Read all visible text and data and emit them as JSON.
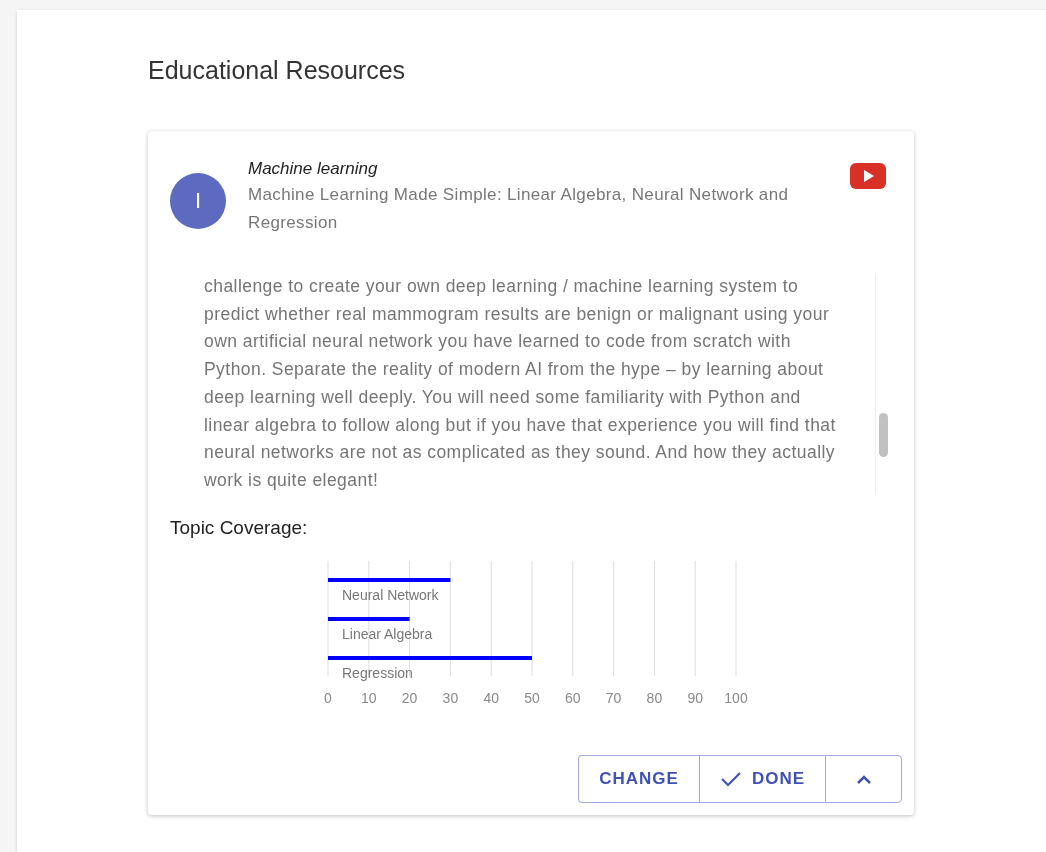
{
  "page": {
    "title": "Educational Resources"
  },
  "resource": {
    "avatar": "I",
    "topic": "Machine learning",
    "title": "Machine Learning Made Simple: Linear Algebra, Neural Network and Regression",
    "description": "challenge to create your own deep learning / machine learning system to predict whether real mammogram results are benign or malignant using your own artificial neural network you have learned to code from scratch with Python. Separate the reality of modern AI from the hype – by learning about deep learning well deeply. You will need some familiarity with Python and linear algebra to follow along but if you have that experience you will find that neural networks are not as complicated as they sound. And how they actually work is quite elegant!"
  },
  "coverage": {
    "label": "Topic Coverage:",
    "chart_data": {
      "type": "bar",
      "orientation": "horizontal",
      "categories": [
        "Neural Network",
        "Linear Algebra",
        "Regression"
      ],
      "series": [
        {
          "color": "#0000ff",
          "values": [
            30,
            20,
            50
          ]
        }
      ],
      "grid": true,
      "xlim": [
        0,
        100
      ],
      "xticks": [
        0,
        10,
        20,
        30,
        40,
        50,
        60,
        70,
        80,
        90,
        100
      ]
    }
  },
  "actions": [
    {
      "kind": "text",
      "label": "CHANGE"
    },
    {
      "kind": "check",
      "label": "DONE"
    },
    {
      "kind": "collapse"
    }
  ]
}
